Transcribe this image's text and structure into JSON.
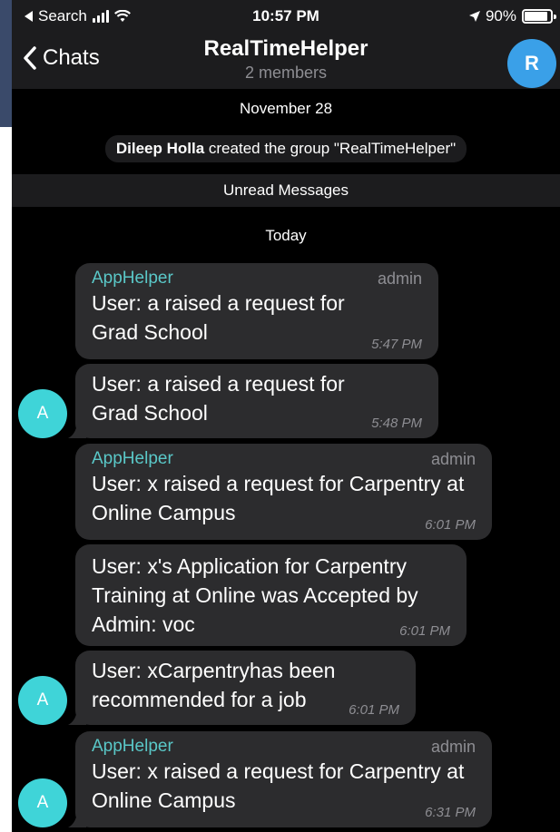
{
  "status": {
    "back_label": "Search",
    "time": "10:57 PM",
    "battery": "90%",
    "battery_level": 0.9
  },
  "nav": {
    "back_label": "Chats",
    "title": "RealTimeHelper",
    "subtitle": "2 members",
    "avatar_letter": "R"
  },
  "service": {
    "date_old": "November 28",
    "created_by": "Dileep Holla",
    "created_text": " created the group \"RealTimeHelper\"",
    "unread": "Unread Messages",
    "date_today": "Today"
  },
  "messages": [
    {
      "sender": "AppHelper",
      "role": "admin",
      "text": "User: a raised a request for Grad School",
      "time": "5:47 PM"
    },
    {
      "text": "User: a raised a request for Grad School",
      "time": "5:48 PM",
      "avatar": "A"
    },
    {
      "sender": "AppHelper",
      "role": "admin",
      "text": "User: x raised a request for Carpentry at Online Campus",
      "time": "6:01 PM"
    },
    {
      "text": "User: x's Application for Carpentry Training at Online was Accepted by Admin: voc",
      "time": "6:01 PM"
    },
    {
      "text": "User: xCarpentryhas been recommended for a job",
      "time": "6:01 PM",
      "avatar": "A"
    },
    {
      "sender": "AppHelper",
      "role": "admin",
      "text": "User: x raised a request for Carpentry at Online Campus",
      "time": "6:31 PM",
      "avatar": "A"
    }
  ],
  "colors": {
    "background": "#000000",
    "bar": "#1c1c1e",
    "bubble": "#2c2c2e",
    "sender": "#5ac8c8",
    "avatar_group": "#3aa0e8",
    "avatar_user": "#3fd4d8"
  }
}
